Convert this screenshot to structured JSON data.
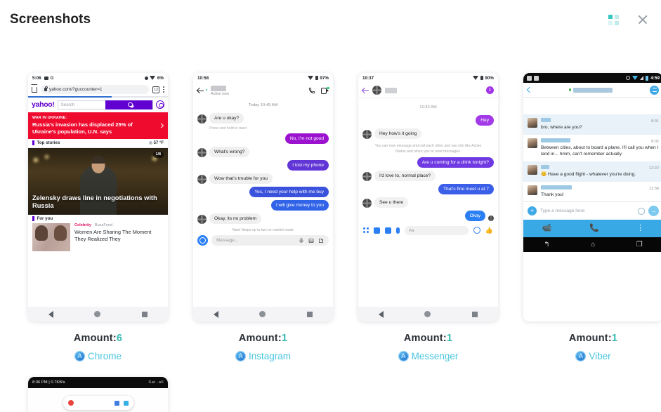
{
  "header": {
    "title": "Screenshots",
    "grid_icon": "grid-view-icon",
    "close_icon": "close-icon"
  },
  "cards": [
    {
      "app": "Chrome",
      "amount_label": "Amount:",
      "amount_value": "6",
      "phone": {
        "status_time": "5:06",
        "status_battery": "6%",
        "url": "yahoo.com/?guccounter=1",
        "tab_count": "12",
        "brand": "yahoo!",
        "search_placeholder": "Search",
        "banner_kicker": "WAR IN UKRAINE:",
        "banner_headline": "Russia's invasion has displaced 25% of Ukraine's population, U.N. says",
        "section_top": "Top stories",
        "weather": "57 °F",
        "hero_badge": "1/8",
        "hero_title": "Zelensky draws line in negotiations with Russia",
        "section_foryou": "For you",
        "article_category": "Celebrity",
        "article_source": "BuzzFeed",
        "article_title": "Women Are Sharing The Moment They Realized They"
      }
    },
    {
      "app": "Instagram",
      "amount_label": "Amount:",
      "amount_value": "1",
      "phone": {
        "status_time": "10:58",
        "status_battery": "97%",
        "active_status": "Active now",
        "day_stamp": "Today 10:45 AM",
        "react_hint": "Press and hold to react",
        "vanish_hint": "New! Swipe up to turn on vanish mode",
        "composer_placeholder": "Message...",
        "messages": [
          {
            "from": "them",
            "text": "Are u okay?"
          },
          {
            "from": "me",
            "text": "No, I'm not good"
          },
          {
            "from": "them",
            "text": "What's wrong?"
          },
          {
            "from": "me",
            "text": "I lost my phone"
          },
          {
            "from": "them",
            "text": "Wow that's trouble for you"
          },
          {
            "from": "me",
            "text": "Yes, I need your help with me buy"
          },
          {
            "from": "me",
            "text": "I will give money to you"
          },
          {
            "from": "them",
            "text": "Okay, its no problem"
          }
        ]
      }
    },
    {
      "app": "Messenger",
      "amount_label": "Amount:",
      "amount_value": "1",
      "phone": {
        "status_time": "10:37",
        "status_battery": "90%",
        "time_stamp": "10:33 AM",
        "system_note": "You can now message and call each other and see info like Active Status and when you've read messages.",
        "composer_placeholder": "Aa",
        "messages": [
          {
            "from": "me",
            "text": "Hey"
          },
          {
            "from": "them",
            "text": "Hey how's it going"
          },
          {
            "from": "me",
            "text": "Are u coming for a drink tonight?"
          },
          {
            "from": "them",
            "text": "I'd love to, normal place?"
          },
          {
            "from": "me",
            "text": "That's fine meet u at 7"
          },
          {
            "from": "them",
            "text": "See u there"
          },
          {
            "from": "me",
            "text": "Okay"
          }
        ]
      }
    },
    {
      "app": "Viber",
      "amount_label": "Amount:",
      "amount_value": "1",
      "phone": {
        "status_time": "4:59",
        "composer_placeholder": "Type a message here",
        "messages": [
          {
            "time": "8:01",
            "text": "bro, where are you?"
          },
          {
            "time": "8:02",
            "text": "Between cities, about to board a plane. I'll call you when I land in... hmm, can't remember actually."
          },
          {
            "time": "12:22",
            "text": "😊 Have a good flight - whatever you're doing."
          },
          {
            "time": "12:34",
            "text": "Thank you!"
          }
        ]
      }
    }
  ],
  "partial_card": {
    "status_left": "8:36 PM | 0.7KB/s",
    "status_right": "Sat .all"
  },
  "colors": {
    "accent_teal": "#35b8b0",
    "app_link": "#49c5df",
    "yahoo_purple": "#6001d2",
    "banner_red": "#ef0b2e",
    "messenger_blue": "#2b7ff5",
    "viber_blue": "#39a9e5",
    "instagram_purple": "#8a2be2"
  }
}
